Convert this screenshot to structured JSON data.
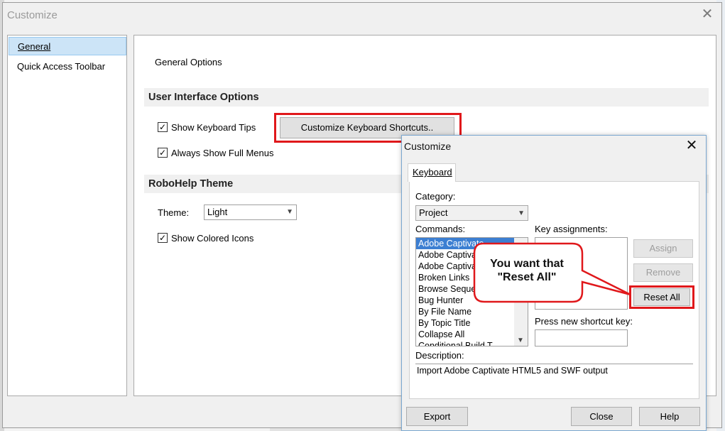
{
  "outer_window": {
    "title": "Customize",
    "nav": [
      "General",
      "Quick Access Toolbar"
    ],
    "heading": "General Options",
    "section_ui": "User Interface Options",
    "show_keyboard_tips": "Show Keyboard Tips",
    "always_show_full_menus": "Always Show Full Menus",
    "customize_shortcuts_button": "Customize Keyboard Shortcuts..",
    "section_theme": "RoboHelp Theme",
    "theme_label": "Theme:",
    "theme_value": "Light",
    "show_colored_icons": "Show Colored Icons"
  },
  "inner_dialog": {
    "title": "Customize",
    "tab": "Keyboard",
    "category_label": "Category:",
    "category_value": "Project",
    "commands_label": "Commands:",
    "commands": [
      "Adobe Captivate",
      "Adobe Captiva",
      "Adobe Captiva",
      "Broken Links",
      "Browse Seque",
      "Bug Hunter",
      "By File Name",
      "By Topic Title",
      "Collapse All",
      "Conditional Build T"
    ],
    "key_assignments_label": "Key assignments:",
    "assign_button": "Assign",
    "remove_button": "Remove",
    "reset_all_button": "Reset All",
    "press_new_shortcut_label": "Press new shortcut key:",
    "description_label": "Description:",
    "description_text": "Import Adobe Captivate HTML5 and SWF output",
    "export_button": "Export",
    "close_button": "Close",
    "help_button": "Help"
  },
  "callout": {
    "text_line1": "You want that",
    "text_line2": "\"Reset All\""
  },
  "colors": {
    "highlight_red": "#e0181b",
    "selection_blue": "#3c7fd2",
    "nav_selection": "#cce4f7"
  }
}
